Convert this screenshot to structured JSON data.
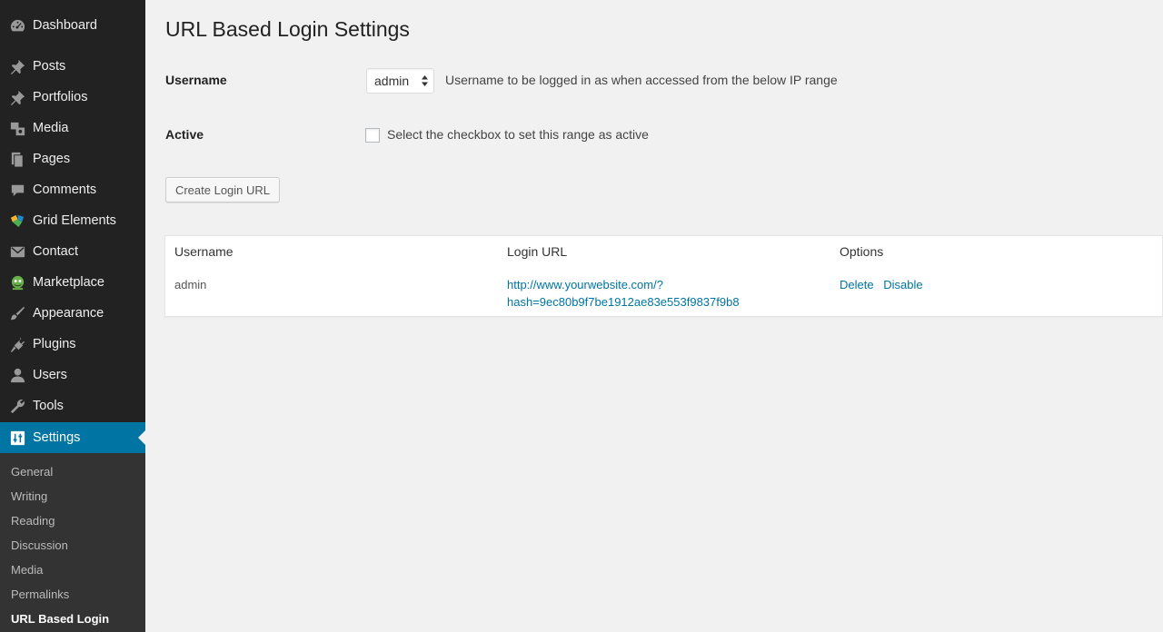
{
  "sidebar": {
    "items": [
      {
        "label": "Dashboard",
        "icon": "dashboard-icon"
      },
      {
        "label": "Posts",
        "icon": "pin-icon"
      },
      {
        "label": "Portfolios",
        "icon": "pin-icon"
      },
      {
        "label": "Media",
        "icon": "media-icon"
      },
      {
        "label": "Pages",
        "icon": "pages-icon"
      },
      {
        "label": "Comments",
        "icon": "comment-icon"
      },
      {
        "label": "Grid Elements",
        "icon": "grid-elements-icon"
      },
      {
        "label": "Contact",
        "icon": "mail-icon"
      },
      {
        "label": "Marketplace",
        "icon": "marketplace-icon"
      },
      {
        "label": "Appearance",
        "icon": "paintbrush-icon"
      },
      {
        "label": "Plugins",
        "icon": "plugin-icon"
      },
      {
        "label": "Users",
        "icon": "user-icon"
      },
      {
        "label": "Tools",
        "icon": "wrench-icon"
      },
      {
        "label": "Settings",
        "icon": "settings-icon",
        "current": true
      }
    ],
    "submenu": [
      {
        "label": "General"
      },
      {
        "label": "Writing"
      },
      {
        "label": "Reading"
      },
      {
        "label": "Discussion"
      },
      {
        "label": "Media"
      },
      {
        "label": "Permalinks"
      },
      {
        "label": "URL Based Login",
        "current": true
      }
    ]
  },
  "main": {
    "title": "URL Based Login Settings",
    "username_field": {
      "label": "Username",
      "selected": "admin",
      "description": "Username to be logged in as when accessed from the below IP range"
    },
    "active_field": {
      "label": "Active",
      "checked": false,
      "description": "Select the checkbox to set this range as active"
    },
    "create_button": "Create Login URL",
    "table": {
      "headers": [
        "Username",
        "Login URL",
        "Options"
      ],
      "rows": [
        {
          "username": "admin",
          "url_line1": "http://www.yourwebsite.com/?",
          "url_line2": "hash=9ec80b9f7be1912ae83e553f9837f9b8",
          "actions": [
            "Delete",
            "Disable"
          ]
        }
      ]
    }
  },
  "colors": {
    "sidebar_bg": "#222222",
    "submenu_bg": "#333333",
    "accent": "#0074a2",
    "page_bg": "#f1f1f1"
  }
}
